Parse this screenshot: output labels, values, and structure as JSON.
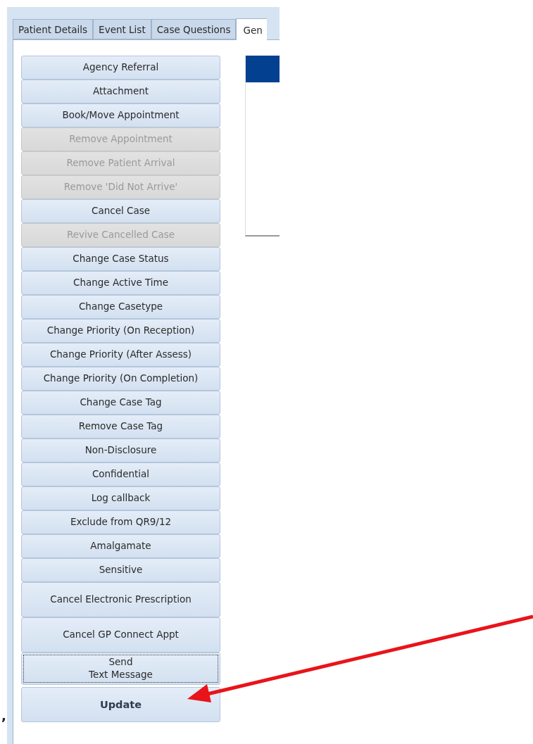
{
  "tabs": [
    {
      "label": "Patient Details",
      "selected": false
    },
    {
      "label": "Event List",
      "selected": false
    },
    {
      "label": "Case Questions",
      "selected": false
    },
    {
      "label": "Gen",
      "selected": true
    }
  ],
  "actions": [
    {
      "label": "Agency Referral",
      "kind": "standard",
      "disabled": false,
      "focused": false
    },
    {
      "label": "Attachment",
      "kind": "standard",
      "disabled": false,
      "focused": false
    },
    {
      "label": "Book/Move Appointment",
      "kind": "standard",
      "disabled": false,
      "focused": false
    },
    {
      "label": "Remove Appointment",
      "kind": "standard",
      "disabled": true,
      "focused": false
    },
    {
      "label": "Remove Patient Arrival",
      "kind": "standard",
      "disabled": true,
      "focused": false
    },
    {
      "label": "Remove 'Did Not Arrive'",
      "kind": "standard",
      "disabled": true,
      "focused": false
    },
    {
      "label": "Cancel Case",
      "kind": "standard",
      "disabled": false,
      "focused": false
    },
    {
      "label": "Revive Cancelled Case",
      "kind": "standard",
      "disabled": true,
      "focused": false
    },
    {
      "label": "Change Case Status",
      "kind": "standard",
      "disabled": false,
      "focused": false
    },
    {
      "label": "Change Active Time",
      "kind": "standard",
      "disabled": false,
      "focused": false
    },
    {
      "label": "Change Casetype",
      "kind": "standard",
      "disabled": false,
      "focused": false
    },
    {
      "label": "Change Priority (On Reception)",
      "kind": "standard",
      "disabled": false,
      "focused": false
    },
    {
      "label": "Change Priority (After Assess)",
      "kind": "standard",
      "disabled": false,
      "focused": false
    },
    {
      "label": "Change Priority (On Completion)",
      "kind": "standard",
      "disabled": false,
      "focused": false
    },
    {
      "label": "Change Case Tag",
      "kind": "standard",
      "disabled": false,
      "focused": false
    },
    {
      "label": "Remove Case Tag",
      "kind": "standard",
      "disabled": false,
      "focused": false
    },
    {
      "label": "Non-Disclosure",
      "kind": "standard",
      "disabled": false,
      "focused": false
    },
    {
      "label": "Confidential",
      "kind": "standard",
      "disabled": false,
      "focused": false
    },
    {
      "label": "Log callback",
      "kind": "standard",
      "disabled": false,
      "focused": false
    },
    {
      "label": "Exclude from QR9/12",
      "kind": "standard",
      "disabled": false,
      "focused": false
    },
    {
      "label": "Amalgamate",
      "kind": "standard",
      "disabled": false,
      "focused": false
    },
    {
      "label": "Sensitive",
      "kind": "standard",
      "disabled": false,
      "focused": false
    },
    {
      "label": "Cancel Electronic Prescription",
      "kind": "tall",
      "disabled": false,
      "focused": false
    },
    {
      "label": "Cancel GP Connect Appt",
      "kind": "tall",
      "disabled": false,
      "focused": false
    },
    {
      "label": "Send\nText Message",
      "kind": "medium",
      "disabled": false,
      "focused": true
    },
    {
      "label": "Update",
      "kind": "update",
      "disabled": false,
      "focused": false
    }
  ],
  "stray_mark": ","
}
